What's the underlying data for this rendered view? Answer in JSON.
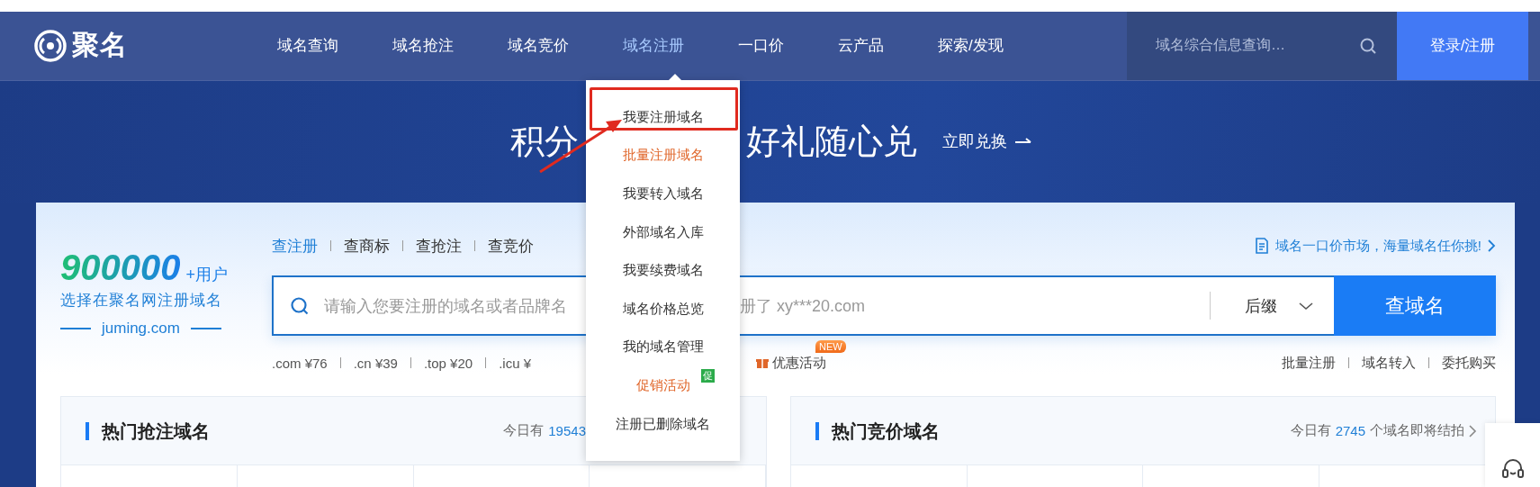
{
  "nav": {
    "logo": "聚名",
    "items": [
      {
        "label": "域名查询",
        "selected": false
      },
      {
        "label": "域名抢注",
        "selected": false
      },
      {
        "label": "域名竞价",
        "selected": false
      },
      {
        "label": "域名注册",
        "selected": true
      },
      {
        "label": "一口价",
        "selected": false
      },
      {
        "label": "云产品",
        "selected": false
      },
      {
        "label": "探索/发现",
        "selected": false
      }
    ],
    "search": {
      "placeholder": "域名综合信息查询…"
    },
    "login": "登录/注册"
  },
  "banner": {
    "title_before": "积分",
    "title_after": "好礼随心兑",
    "link": "立即兑换"
  },
  "promo": {
    "count": "900000",
    "count_suffix": "+用户",
    "tagline": "选择在聚名网注册域名",
    "site": "juming.com"
  },
  "search_tabs": [
    {
      "label": "查注册",
      "selected": true
    },
    {
      "label": "查商标",
      "selected": false
    },
    {
      "label": "查抢注",
      "selected": false
    },
    {
      "label": "查竞价",
      "selected": false
    }
  ],
  "market_link": "域名一口价市场，海量域名任你挑!",
  "domain_search": {
    "placeholder_before": "请输入您要注册的域名或者品牌名",
    "placeholder_after": "册了 xy***20.com",
    "suffix": "后缀",
    "button": "查域名"
  },
  "prices": [
    ".com ¥76",
    ".cn ¥39",
    ".top ¥20",
    ".icu ¥"
  ],
  "promo_link": {
    "label": "优惠活动",
    "badge": "NEW"
  },
  "quick_links": [
    "批量注册",
    "域名转入",
    "委托购买"
  ],
  "panels": [
    {
      "title": "热门抢注域名",
      "summary_before": "今日有",
      "count": "19543"
    },
    {
      "title": "热门竞价域名",
      "summary_before": "今日有",
      "count": "2745",
      "summary_after": "个域名即将结拍"
    }
  ],
  "dropdown": {
    "items": [
      {
        "label": "我要注册域名",
        "color": "#333333",
        "annotated": true
      },
      {
        "label": "批量注册域名",
        "color": "#e0662a",
        "annotated": false
      },
      {
        "label": "我要转入域名",
        "color": "#333333",
        "annotated": false
      },
      {
        "label": "外部域名入库",
        "color": "#333333",
        "annotated": false
      },
      {
        "label": "我要续费域名",
        "color": "#333333",
        "annotated": false
      },
      {
        "label": "域名价格总览",
        "color": "#333333",
        "annotated": false
      },
      {
        "label": "我的域名管理",
        "color": "#333333",
        "annotated": false
      },
      {
        "label": "促销活动",
        "color": "#e0662a",
        "annotated": false,
        "badge": "促"
      },
      {
        "label": "注册已删除域名",
        "color": "#333333",
        "annotated": false
      }
    ]
  }
}
